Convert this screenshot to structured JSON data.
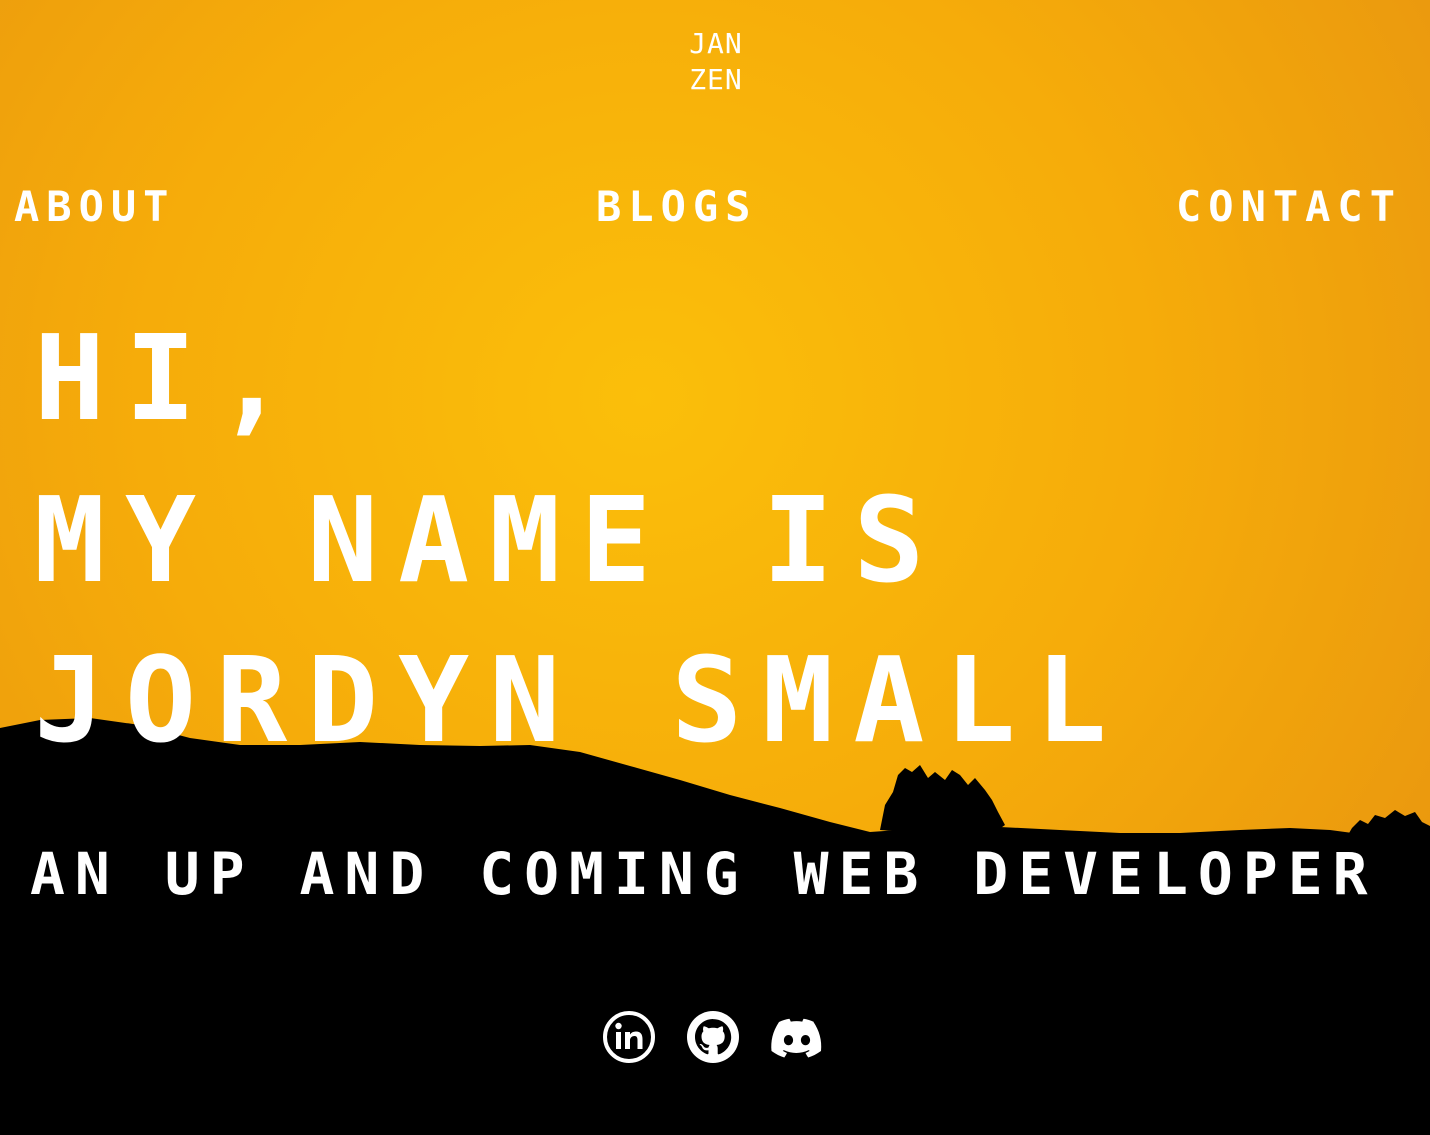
{
  "brand": {
    "logo_line1": "JAN",
    "logo_line2": "ZEN"
  },
  "nav": {
    "about": "ABOUT",
    "blogs": "BLOGS",
    "contact": "CONTACT"
  },
  "hero": {
    "line1": "HI,",
    "line2": "MY NAME IS",
    "line3": "JORDYN SMALL",
    "subtitle": "AN UP AND COMING WEB DEVELOPER"
  },
  "socials": [
    {
      "icon": "linkedin-icon"
    },
    {
      "icon": "github-icon"
    },
    {
      "icon": "discord-icon"
    }
  ],
  "colors": {
    "sky": "#f6ac0a",
    "silhouette": "#000000",
    "text": "#ffffff"
  }
}
